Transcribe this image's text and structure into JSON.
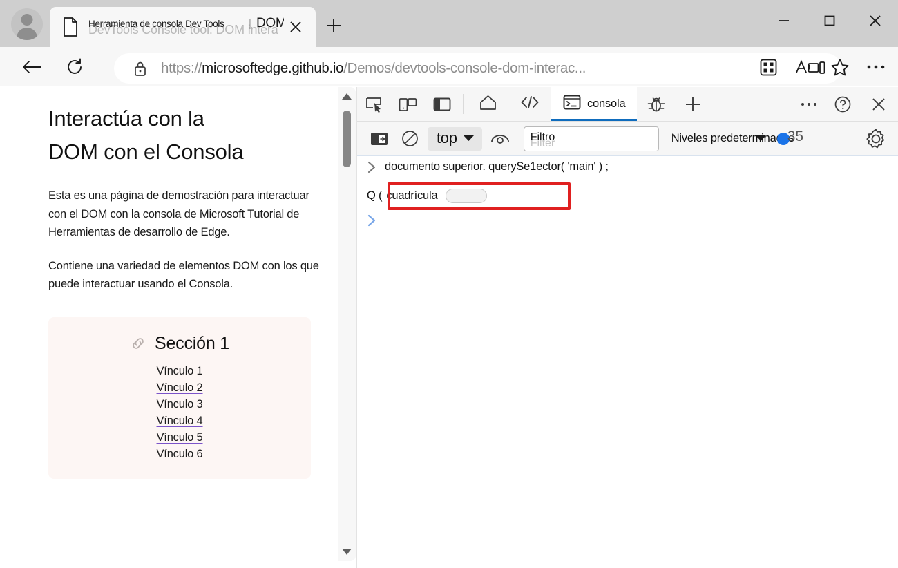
{
  "window": {
    "minimize_label": "Minimizar",
    "maximize_label": "Maximizar",
    "close_label": "Cerrar"
  },
  "browser": {
    "tab": {
      "title_translated": "Herramienta de consola Dev Tools",
      "title_separator": "|",
      "title_translated_2": "DOM intel",
      "title_original_ghost": "DevTools Console tool: DOM intera",
      "favicon": "document-icon",
      "close_label": "Cerrar pestaña"
    },
    "new_tab_label": "Nueva pestaña",
    "back_label": "Atrás",
    "refresh_label": "Actualizar",
    "url_scheme": "https://",
    "url_host": "microsoftedge.github.io",
    "url_path": "/Demos/devtools-console-dom-interac...",
    "lock_icon": "lock-icon",
    "toolbar_icons": [
      "split-screen-icon",
      "browser-essentials-icon",
      "read-aloud-icon",
      "favorite-star-icon",
      "settings-more-icon"
    ]
  },
  "page": {
    "heading": "Interactúa con la DOM con el Consola",
    "paragraphs": [
      "Esta es una página de demostración para interactuar con el DOM con la consola de Microsoft Tutorial de Herramientas de desarrollo de Edge.",
      "Contiene una variedad de elementos DOM con los que puede interactuar usando el Consola."
    ],
    "section": {
      "icon": "link-anchor-icon",
      "title": "Sección 1",
      "links": [
        "Vínculo 1",
        "Vínculo 2",
        "Vínculo 3",
        "Vínculo 4",
        "Vínculo 5",
        "Vínculo 6"
      ]
    },
    "card_bg": "#fdf6f4",
    "link_underline_color": "#7b54c9"
  },
  "devtools": {
    "tools": [
      "inspect-element-icon",
      "device-emulation-icon",
      "dock-side-icon"
    ],
    "panel_tabs": [
      {
        "icon": "home-icon",
        "label": ""
      },
      {
        "icon": "elements-code-icon",
        "label": ""
      },
      {
        "icon": "console-terminal-icon",
        "label": "consola",
        "active": true
      }
    ],
    "right_tools": [
      "issues-bug-icon",
      "add-tool-plus-icon",
      "more-tools-icon",
      "help-question-icon",
      "close-devtools-icon"
    ],
    "accent_color": "#0f6cbd",
    "console_toolbar": {
      "sidebar_toggle_icon": "console-sidebar-icon",
      "clear_icon": "clear-console-icon",
      "context_selector": "top",
      "context_caret": "▼",
      "live_expression_icon": "eye-icon",
      "filter_value": "Filtro",
      "filter_placeholder_ghost": "Filter",
      "levels_label": "Niveles predeterminados",
      "levels_caret": "▼",
      "issues_count": "35",
      "issues_badge_color": "#1a73e8",
      "settings_icon": "gear-icon"
    },
    "console": {
      "entries": [
        {
          "type": "command",
          "chevron": "❯",
          "text": "documento superior. querySe1ector( 'main' ) ;"
        },
        {
          "type": "result",
          "prefix": "Q (",
          "text": "cuadrícula",
          "badge": "grid-badge",
          "highlighted": true,
          "highlight_color": "#e02020"
        }
      ],
      "prompt_chevron": "❯"
    }
  }
}
